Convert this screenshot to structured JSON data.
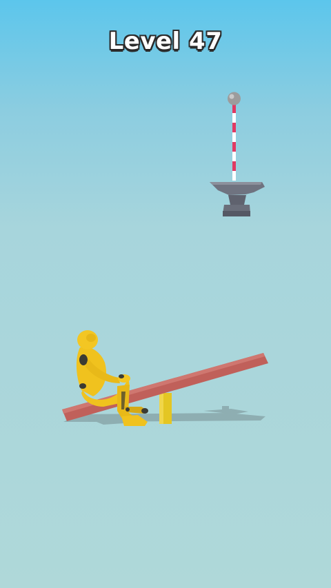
{
  "hud": {
    "level_label": "Level 47"
  },
  "colors": {
    "sky_top": "#5cc6ec",
    "ground": "#afd8d9",
    "seesaw_plank": "#c0605a",
    "seesaw_post": "#e4c623",
    "figure": "#f0c21e",
    "anvil": "#6f7380",
    "rope_red": "#e03a63",
    "rope_white": "#ffffff",
    "anchor_ball": "#9a9a9a"
  },
  "scene": {
    "objects": [
      "anchor-ball",
      "striped-rope",
      "anvil",
      "seesaw",
      "crash-dummy"
    ]
  }
}
